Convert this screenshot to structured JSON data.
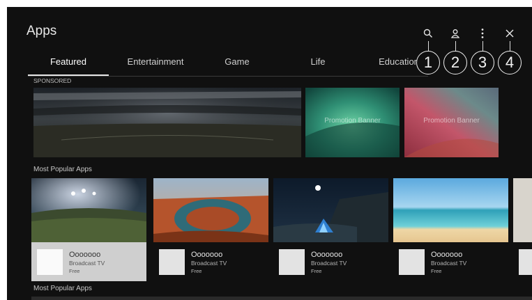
{
  "header": {
    "title": "Apps"
  },
  "tabs": [
    {
      "label": "Featured",
      "active": true
    },
    {
      "label": "Entertainment",
      "active": false
    },
    {
      "label": "Game",
      "active": false
    },
    {
      "label": "Life",
      "active": false
    },
    {
      "label": "Education",
      "active": false
    }
  ],
  "toolbar": {
    "icons": [
      "search-icon",
      "account-icon",
      "more-options-icon",
      "close-icon"
    ],
    "callouts": [
      "1",
      "2",
      "3",
      "4"
    ]
  },
  "sponsored": {
    "label": "SPONSORED",
    "banners": [
      {
        "text": ""
      },
      {
        "text": "Promotion Banner"
      },
      {
        "text": "Promotion Banner"
      }
    ]
  },
  "sections": [
    {
      "label": "Most Popular Apps",
      "cards": [
        {
          "name": "Ooooooo",
          "category": "Broadcast TV",
          "price": "Free"
        },
        {
          "name": "Ooooooo",
          "category": "Broadcast TV",
          "price": "Free"
        },
        {
          "name": "Ooooooo",
          "category": "Broadcast TV",
          "price": "Free"
        },
        {
          "name": "Ooooooo",
          "category": "Broadcast TV",
          "price": "Free"
        }
      ]
    },
    {
      "label": "Most Popular Apps"
    }
  ],
  "colors": {
    "background": "#101010",
    "focus": "#cfcfcf",
    "text": "#e8e8e8"
  }
}
